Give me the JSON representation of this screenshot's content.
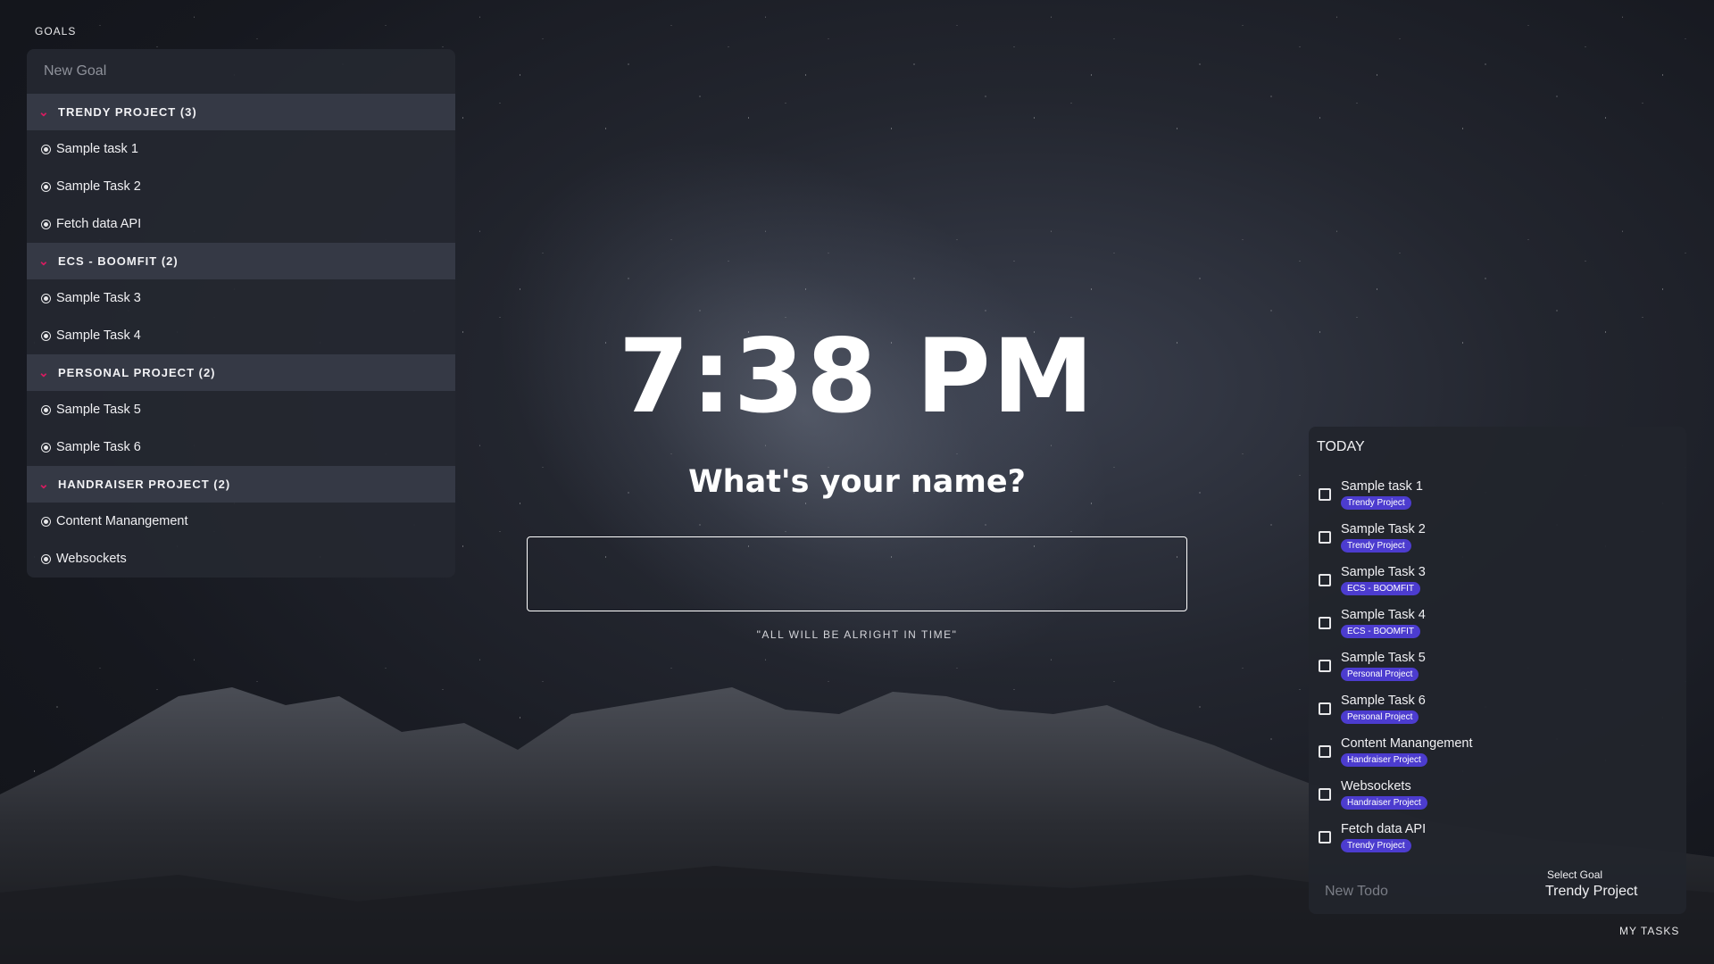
{
  "goals": {
    "title": "GOALS",
    "new_goal_placeholder": "New Goal",
    "groups": [
      {
        "header": "TRENDY PROJECT (3)",
        "tasks": [
          "Sample task 1",
          "Sample Task 2",
          "Fetch data API"
        ]
      },
      {
        "header": "ECS - BOOMFIT (2)",
        "tasks": [
          "Sample Task 3",
          "Sample Task 4"
        ]
      },
      {
        "header": "PERSONAL PROJECT (2)",
        "tasks": [
          "Sample Task 5",
          "Sample Task 6"
        ]
      },
      {
        "header": "HANDRAISER PROJECT (2)",
        "tasks": [
          "Content Manangement",
          "Websockets"
        ]
      }
    ]
  },
  "center": {
    "time": "7:38 PM",
    "prompt": "What's your name?",
    "name_value": "",
    "quote": "\"ALL WILL BE ALRIGHT IN TIME\""
  },
  "today": {
    "title": "TODAY",
    "items": [
      {
        "label": "Sample task 1",
        "tag": "Trendy Project"
      },
      {
        "label": "Sample Task 2",
        "tag": "Trendy Project"
      },
      {
        "label": "Sample Task 3",
        "tag": "ECS - BOOMFIT"
      },
      {
        "label": "Sample Task 4",
        "tag": "ECS - BOOMFIT"
      },
      {
        "label": "Sample Task 5",
        "tag": "Personal Project"
      },
      {
        "label": "Sample Task 6",
        "tag": "Personal Project"
      },
      {
        "label": "Content Manangement",
        "tag": "Handraiser Project"
      },
      {
        "label": "Websockets",
        "tag": "Handraiser Project"
      },
      {
        "label": "Fetch data API",
        "tag": "Trendy Project"
      }
    ],
    "new_todo_placeholder": "New Todo",
    "select_goal_label": "Select Goal",
    "select_goal_value": "Trendy Project"
  },
  "footer": {
    "my_tasks": "MY TASKS"
  },
  "colors": {
    "accent_chevron": "#d81b60",
    "tag_background": "#4c3ccf"
  }
}
